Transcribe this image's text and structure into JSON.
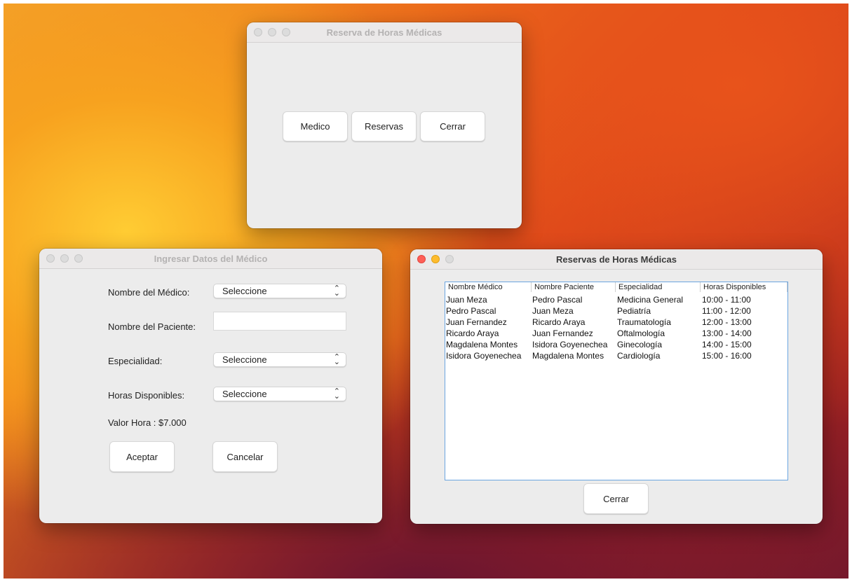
{
  "main_window": {
    "title": "Reserva de Horas Médicas",
    "buttons": {
      "medico": "Medico",
      "reservas": "Reservas",
      "cerrar": "Cerrar"
    }
  },
  "medico_window": {
    "title": "Ingresar Datos del Médico",
    "labels": {
      "nombre_medico": "Nombre del Médico:",
      "nombre_paciente": "Nombre del Paciente:",
      "especialidad": "Especialidad:",
      "horas": "Horas Disponibles:",
      "valor_hora": "Valor Hora : $7.000"
    },
    "selects": {
      "nombre_medico": "Seleccione",
      "especialidad": "Seleccione",
      "horas": "Seleccione"
    },
    "paciente_value": "",
    "buttons": {
      "aceptar": "Aceptar",
      "cancelar": "Cancelar"
    }
  },
  "reservas_window": {
    "title": "Reservas de Horas Médicas",
    "columns": [
      "Nombre Médico",
      "Nombre Paciente",
      "Especialidad",
      "Horas Disponibles"
    ],
    "rows": [
      [
        "Juan Meza",
        "Pedro Pascal",
        "Medicina General",
        "10:00 - 11:00"
      ],
      [
        "Pedro Pascal",
        "Juan Meza",
        "Pediatría",
        "11:00 - 12:00"
      ],
      [
        "Juan Fernandez",
        "Ricardo Araya",
        "Traumatología",
        "12:00 - 13:00"
      ],
      [
        "Ricardo Araya",
        "Juan Fernandez",
        "Oftalmología",
        "13:00 - 14:00"
      ],
      [
        "Magdalena Montes",
        "Isidora Goyenechea",
        "Ginecología",
        "14:00 - 15:00"
      ],
      [
        "Isidora Goyenechea",
        "Magdalena Montes",
        "Cardiología",
        "15:00 - 16:00"
      ]
    ],
    "buttons": {
      "cerrar": "Cerrar"
    }
  }
}
